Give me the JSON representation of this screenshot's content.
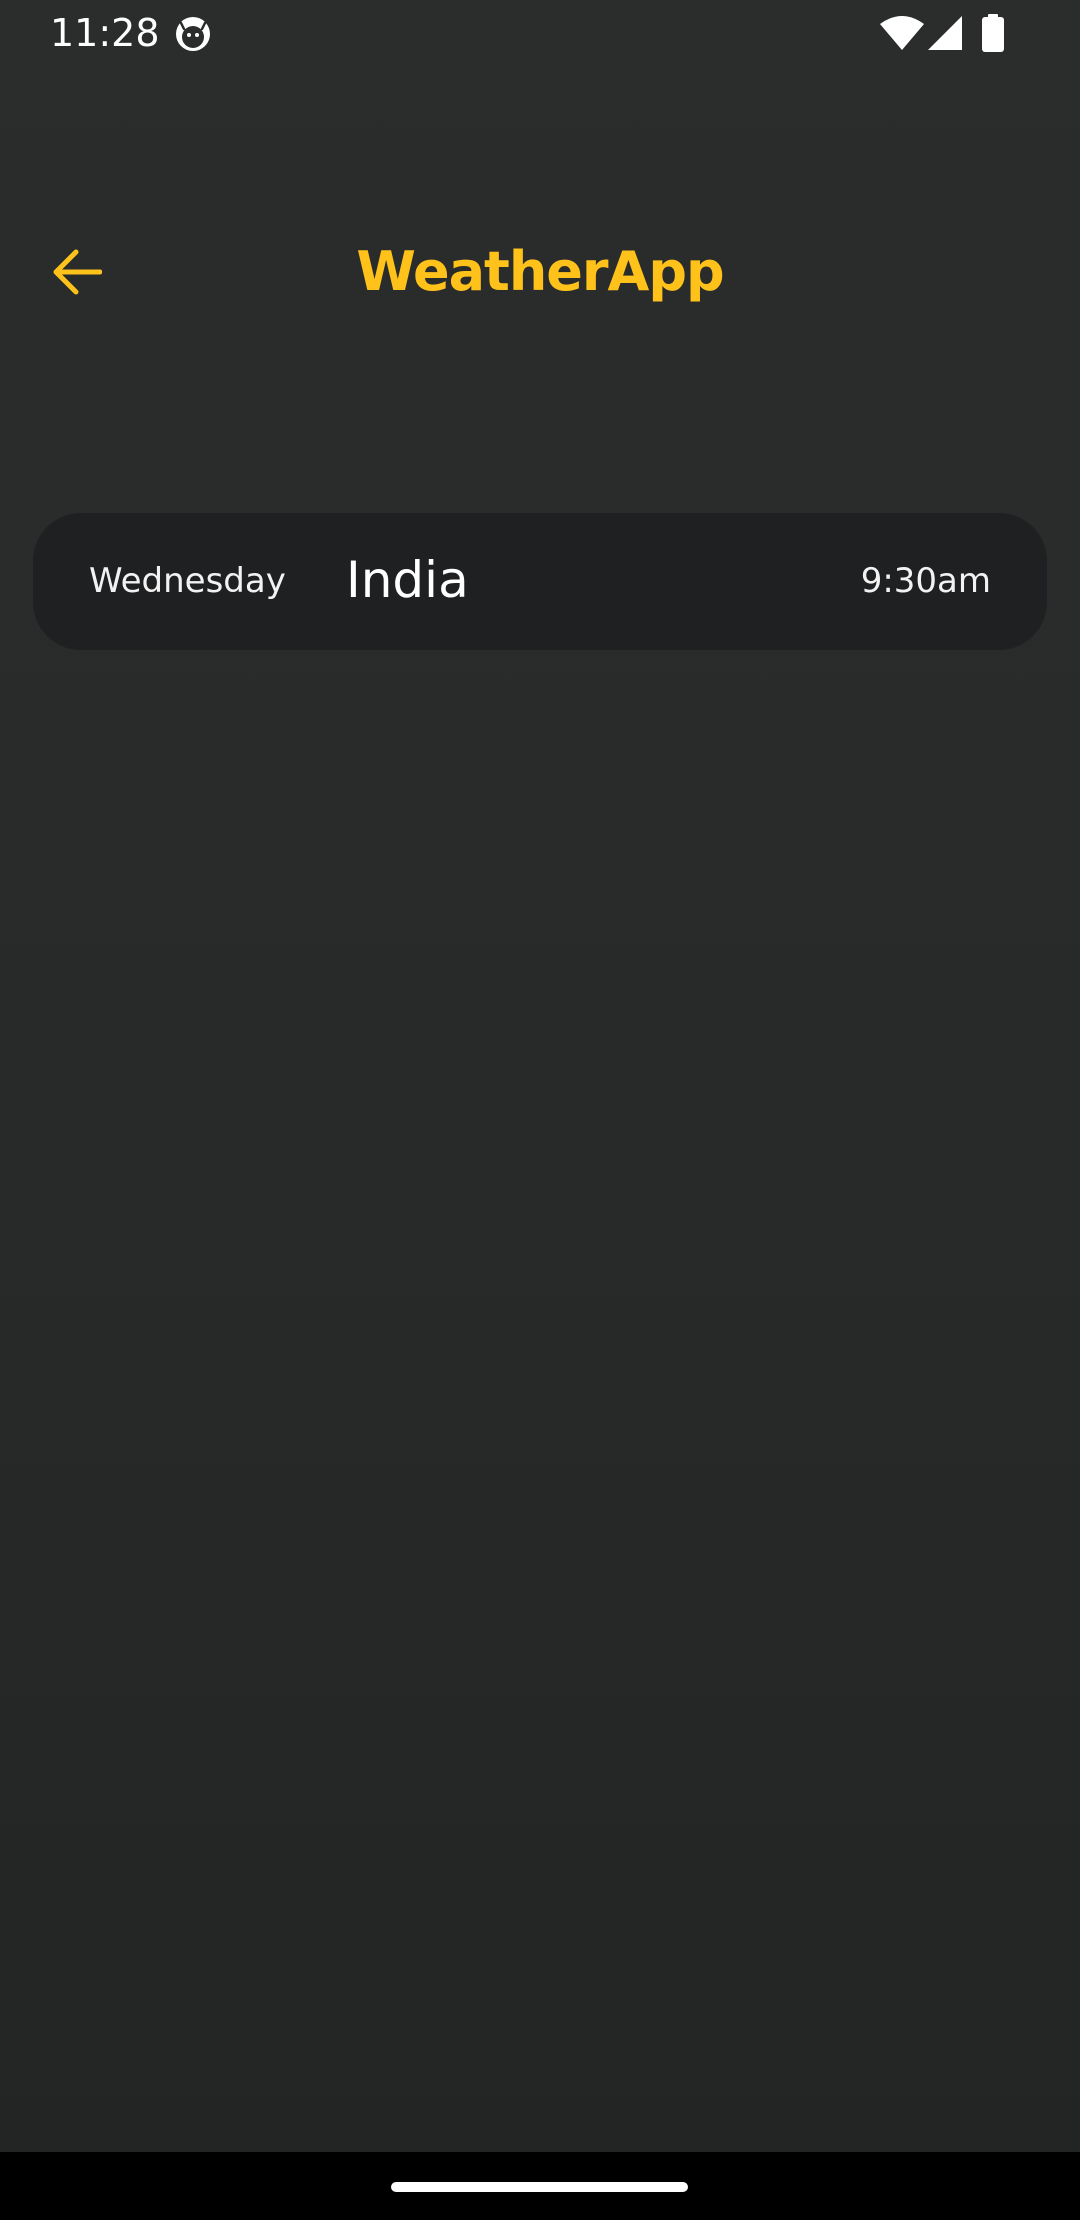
{
  "status_bar": {
    "time": "11:28",
    "app_icon": "android-face-icon",
    "wifi_icon": "wifi-icon",
    "signal_icon": "cell-signal-icon",
    "battery_icon": "battery-icon"
  },
  "app_bar": {
    "back_icon": "arrow-back-icon",
    "title": "WeatherApp"
  },
  "city_list": [
    {
      "day": "Wednesday",
      "country": "India",
      "time": "9:30am"
    }
  ],
  "colors": {
    "accent": "#ffc21a",
    "background": "#2a2b2b",
    "card": "#1f2021",
    "text": "#ffffff"
  }
}
